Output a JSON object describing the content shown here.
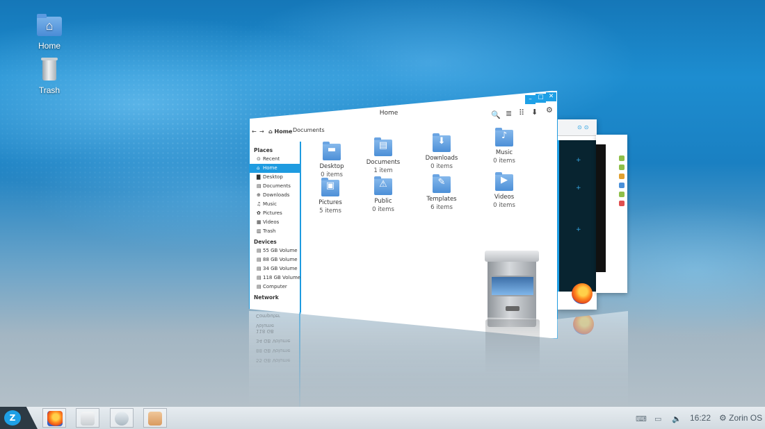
{
  "desktop": {
    "icons": [
      {
        "label": "Home",
        "icon": "home-folder-icon"
      },
      {
        "label": "Trash",
        "icon": "trash-icon"
      }
    ]
  },
  "window": {
    "title": "Home",
    "controls": {
      "minimize": "–",
      "maximize": "☐",
      "close": "✕"
    },
    "toolbar": {
      "search": "🔍",
      "list_view": "≣",
      "grid_view": "⠿",
      "download": "⬇",
      "settings": "⚙"
    },
    "nav": {
      "back": "←",
      "forward": "→",
      "breadcrumb_home": "Home",
      "breadcrumb_documents": "Documents"
    },
    "sidebar": {
      "places_header": "Places",
      "places": [
        {
          "label": "Recent",
          "icon": "⊙"
        },
        {
          "label": "Home",
          "icon": "⌂"
        },
        {
          "label": "Desktop",
          "icon": "▇"
        },
        {
          "label": "Documents",
          "icon": "▤"
        },
        {
          "label": "Downloads",
          "icon": "⊕"
        },
        {
          "label": "Music",
          "icon": "♫"
        },
        {
          "label": "Pictures",
          "icon": "✿"
        },
        {
          "label": "Videos",
          "icon": "▦"
        },
        {
          "label": "Trash",
          "icon": "▥"
        }
      ],
      "devices_header": "Devices",
      "devices": [
        {
          "label": "55 GB Volume",
          "icon": "▤"
        },
        {
          "label": "88 GB Volume",
          "icon": "▤"
        },
        {
          "label": "34 GB Volume",
          "icon": "▤"
        },
        {
          "label": "118 GB Volume",
          "icon": "▤"
        },
        {
          "label": "Computer",
          "icon": "▤"
        }
      ],
      "network_header": "Network"
    },
    "files": [
      {
        "name": "Desktop",
        "count": "0 items",
        "glyph": "▬"
      },
      {
        "name": "Documents",
        "count": "1 item",
        "glyph": "▤"
      },
      {
        "name": "Downloads",
        "count": "0 items",
        "glyph": "⬇"
      },
      {
        "name": "Music",
        "count": "0 items",
        "glyph": "♪"
      },
      {
        "name": "Pictures",
        "count": "5 items",
        "glyph": "▣"
      },
      {
        "name": "Public",
        "count": "0 items",
        "glyph": "⚠"
      },
      {
        "name": "Templates",
        "count": "6 items",
        "glyph": "✎"
      },
      {
        "name": "Videos",
        "count": "0 items",
        "glyph": "▶"
      }
    ]
  },
  "panel": {
    "start_label": "Z",
    "clock": "16:22",
    "os_label": "Zorin OS",
    "tray": {
      "keyboard": "⌨",
      "battery": "▭",
      "volume": "🔈"
    }
  }
}
